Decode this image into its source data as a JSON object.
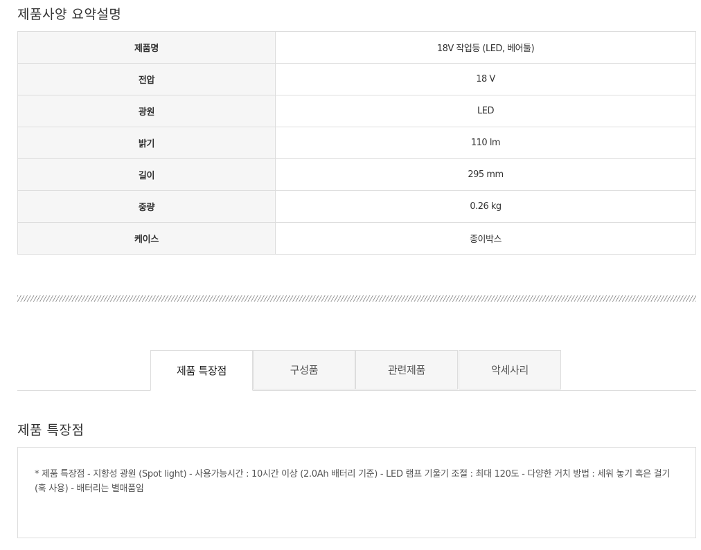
{
  "spec": {
    "title": "제품사양 요약설명",
    "rows": [
      {
        "label": "제품명",
        "value": "18V 작업등 (LED, 베어툴)"
      },
      {
        "label": "전압",
        "value": "18 V"
      },
      {
        "label": "광원",
        "value": "LED"
      },
      {
        "label": "밝기",
        "value": "110 lm"
      },
      {
        "label": "길이",
        "value": "295 mm"
      },
      {
        "label": "중량",
        "value": "0.26 kg"
      },
      {
        "label": "케이스",
        "value": "종이박스"
      }
    ]
  },
  "tabs": [
    {
      "label": "제품 특장점",
      "active": true
    },
    {
      "label": "구성품",
      "active": false
    },
    {
      "label": "관련제품",
      "active": false
    },
    {
      "label": "악세사리",
      "active": false
    }
  ],
  "features": {
    "title": "제품 특장점",
    "text": "* 제품 특장점 - 지향성 광원 (Spot light) - 사용가능시간 : 10시간 이상 (2.0Ah 배터리 기준) - LED 램프 기울기 조절 : 최대 120도 - 다양한 거치 방법 : 세워 놓기 혹은 걸기 (훅 사용) - 배터리는 별매품임"
  }
}
